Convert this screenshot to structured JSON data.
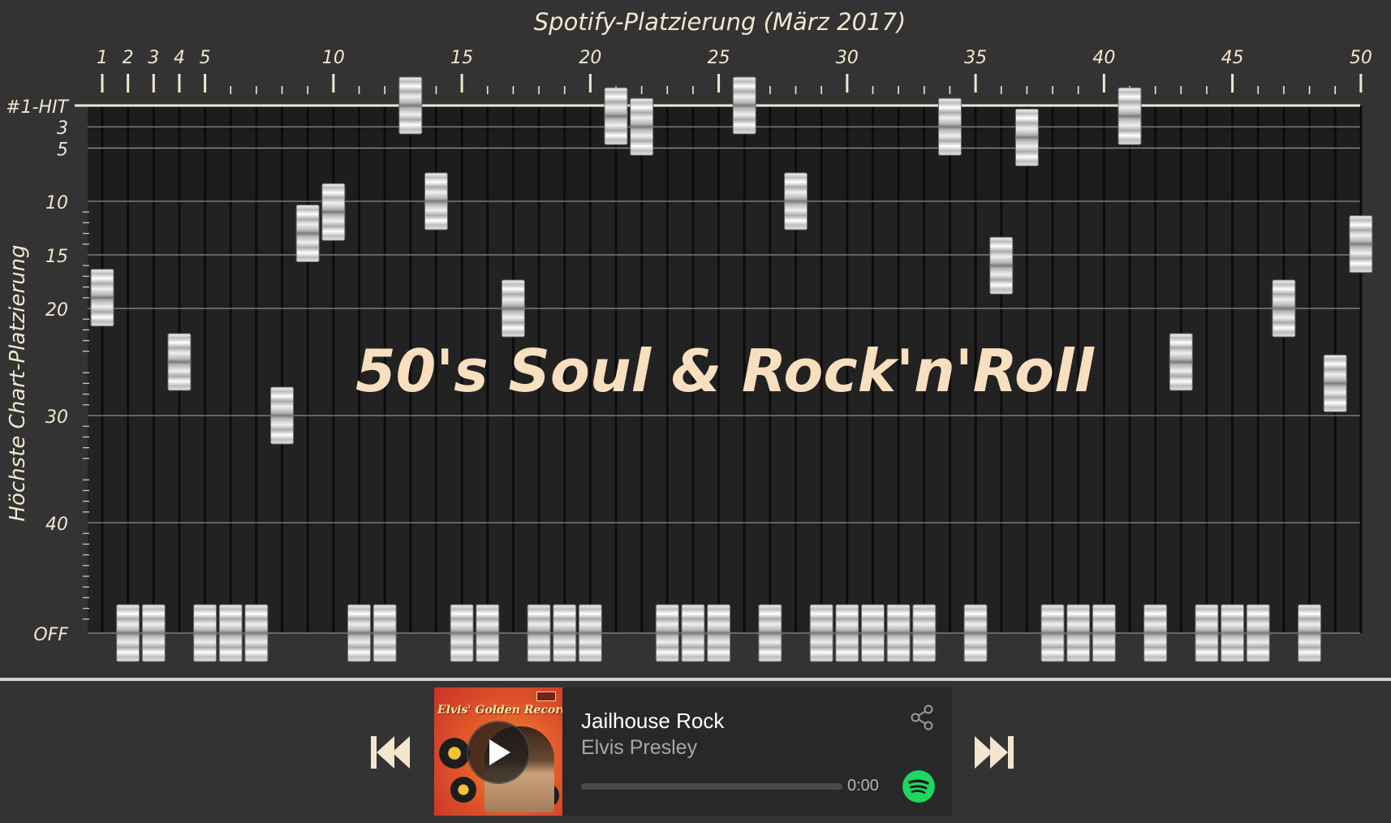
{
  "chart_data": {
    "type": "scatter",
    "title": "Spotify-Platzierung (März 2017)",
    "xlabel": "Spotify-Platzierung (März 2017)",
    "ylabel": "Höchste Chart-Platzierung",
    "x_tick_labels": [
      "1",
      "2",
      "3",
      "4",
      "5",
      "10",
      "15",
      "20",
      "25",
      "30",
      "35",
      "40",
      "45",
      "50"
    ],
    "y_tick_labels": [
      "#1-HIT",
      "3",
      "5",
      "10",
      "15",
      "20",
      "30",
      "40",
      "OFF"
    ],
    "xlim": [
      1,
      50
    ],
    "grid": true,
    "overlay_title": "50's Soul & Rock'n'Roll",
    "points": [
      {
        "x": 1,
        "y": 19
      },
      {
        "x": 2,
        "y": "OFF"
      },
      {
        "x": 3,
        "y": "OFF"
      },
      {
        "x": 4,
        "y": 25
      },
      {
        "x": 5,
        "y": "OFF"
      },
      {
        "x": 6,
        "y": "OFF"
      },
      {
        "x": 7,
        "y": "OFF"
      },
      {
        "x": 8,
        "y": 30
      },
      {
        "x": 9,
        "y": 13
      },
      {
        "x": 10,
        "y": 11
      },
      {
        "x": 11,
        "y": "OFF"
      },
      {
        "x": 12,
        "y": "OFF"
      },
      {
        "x": 13,
        "y": 1
      },
      {
        "x": 14,
        "y": 10
      },
      {
        "x": 15,
        "y": "OFF"
      },
      {
        "x": 16,
        "y": "OFF"
      },
      {
        "x": 17,
        "y": 20
      },
      {
        "x": 18,
        "y": "OFF"
      },
      {
        "x": 19,
        "y": "OFF"
      },
      {
        "x": 20,
        "y": "OFF"
      },
      {
        "x": 21,
        "y": 2
      },
      {
        "x": 22,
        "y": 3
      },
      {
        "x": 23,
        "y": "OFF"
      },
      {
        "x": 24,
        "y": "OFF"
      },
      {
        "x": 25,
        "y": "OFF"
      },
      {
        "x": 26,
        "y": 1
      },
      {
        "x": 27,
        "y": "OFF"
      },
      {
        "x": 28,
        "y": 10
      },
      {
        "x": 29,
        "y": "OFF"
      },
      {
        "x": 30,
        "y": "OFF"
      },
      {
        "x": 31,
        "y": "OFF"
      },
      {
        "x": 32,
        "y": "OFF"
      },
      {
        "x": 33,
        "y": "OFF"
      },
      {
        "x": 34,
        "y": 3
      },
      {
        "x": 35,
        "y": "OFF"
      },
      {
        "x": 36,
        "y": 16
      },
      {
        "x": 37,
        "y": 4
      },
      {
        "x": 38,
        "y": "OFF"
      },
      {
        "x": 39,
        "y": "OFF"
      },
      {
        "x": 40,
        "y": "OFF"
      },
      {
        "x": 41,
        "y": 2
      },
      {
        "x": 42,
        "y": "OFF"
      },
      {
        "x": 43,
        "y": 25
      },
      {
        "x": 44,
        "y": "OFF"
      },
      {
        "x": 45,
        "y": "OFF"
      },
      {
        "x": 46,
        "y": "OFF"
      },
      {
        "x": 47,
        "y": 20
      },
      {
        "x": 48,
        "y": "OFF"
      },
      {
        "x": 49,
        "y": 27
      },
      {
        "x": 50,
        "y": 14
      }
    ]
  },
  "player": {
    "cover_text": "Elvis' Golden Records",
    "track_title": "Jailhouse Rock",
    "artist": "Elvis Presley",
    "time": "0:00",
    "progress": 0,
    "prev_icon": "skip-previous-icon",
    "next_icon": "skip-next-icon",
    "play_icon": "play-icon",
    "share_icon": "share-icon",
    "spotify_icon": "spotify-logo-icon"
  },
  "colors": {
    "background": "#333333",
    "plot_background": "#222222",
    "top_band": "#1d1d1d",
    "text": "#f2e6cf",
    "watermark": "#f7dfbf",
    "spotify_green": "#1ed760"
  }
}
